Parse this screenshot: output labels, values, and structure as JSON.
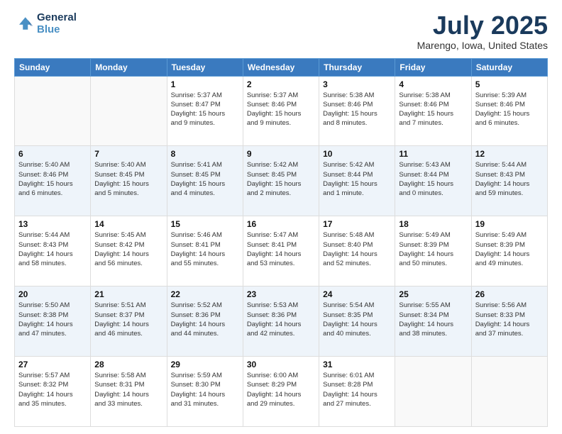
{
  "logo": {
    "line1": "General",
    "line2": "Blue"
  },
  "title": "July 2025",
  "location": "Marengo, Iowa, United States",
  "weekdays": [
    "Sunday",
    "Monday",
    "Tuesday",
    "Wednesday",
    "Thursday",
    "Friday",
    "Saturday"
  ],
  "weeks": [
    [
      {
        "day": "",
        "info": ""
      },
      {
        "day": "",
        "info": ""
      },
      {
        "day": "1",
        "info": "Sunrise: 5:37 AM\nSunset: 8:47 PM\nDaylight: 15 hours\nand 9 minutes."
      },
      {
        "day": "2",
        "info": "Sunrise: 5:37 AM\nSunset: 8:46 PM\nDaylight: 15 hours\nand 9 minutes."
      },
      {
        "day": "3",
        "info": "Sunrise: 5:38 AM\nSunset: 8:46 PM\nDaylight: 15 hours\nand 8 minutes."
      },
      {
        "day": "4",
        "info": "Sunrise: 5:38 AM\nSunset: 8:46 PM\nDaylight: 15 hours\nand 7 minutes."
      },
      {
        "day": "5",
        "info": "Sunrise: 5:39 AM\nSunset: 8:46 PM\nDaylight: 15 hours\nand 6 minutes."
      }
    ],
    [
      {
        "day": "6",
        "info": "Sunrise: 5:40 AM\nSunset: 8:46 PM\nDaylight: 15 hours\nand 6 minutes."
      },
      {
        "day": "7",
        "info": "Sunrise: 5:40 AM\nSunset: 8:45 PM\nDaylight: 15 hours\nand 5 minutes."
      },
      {
        "day": "8",
        "info": "Sunrise: 5:41 AM\nSunset: 8:45 PM\nDaylight: 15 hours\nand 4 minutes."
      },
      {
        "day": "9",
        "info": "Sunrise: 5:42 AM\nSunset: 8:45 PM\nDaylight: 15 hours\nand 2 minutes."
      },
      {
        "day": "10",
        "info": "Sunrise: 5:42 AM\nSunset: 8:44 PM\nDaylight: 15 hours\nand 1 minute."
      },
      {
        "day": "11",
        "info": "Sunrise: 5:43 AM\nSunset: 8:44 PM\nDaylight: 15 hours\nand 0 minutes."
      },
      {
        "day": "12",
        "info": "Sunrise: 5:44 AM\nSunset: 8:43 PM\nDaylight: 14 hours\nand 59 minutes."
      }
    ],
    [
      {
        "day": "13",
        "info": "Sunrise: 5:44 AM\nSunset: 8:43 PM\nDaylight: 14 hours\nand 58 minutes."
      },
      {
        "day": "14",
        "info": "Sunrise: 5:45 AM\nSunset: 8:42 PM\nDaylight: 14 hours\nand 56 minutes."
      },
      {
        "day": "15",
        "info": "Sunrise: 5:46 AM\nSunset: 8:41 PM\nDaylight: 14 hours\nand 55 minutes."
      },
      {
        "day": "16",
        "info": "Sunrise: 5:47 AM\nSunset: 8:41 PM\nDaylight: 14 hours\nand 53 minutes."
      },
      {
        "day": "17",
        "info": "Sunrise: 5:48 AM\nSunset: 8:40 PM\nDaylight: 14 hours\nand 52 minutes."
      },
      {
        "day": "18",
        "info": "Sunrise: 5:49 AM\nSunset: 8:39 PM\nDaylight: 14 hours\nand 50 minutes."
      },
      {
        "day": "19",
        "info": "Sunrise: 5:49 AM\nSunset: 8:39 PM\nDaylight: 14 hours\nand 49 minutes."
      }
    ],
    [
      {
        "day": "20",
        "info": "Sunrise: 5:50 AM\nSunset: 8:38 PM\nDaylight: 14 hours\nand 47 minutes."
      },
      {
        "day": "21",
        "info": "Sunrise: 5:51 AM\nSunset: 8:37 PM\nDaylight: 14 hours\nand 46 minutes."
      },
      {
        "day": "22",
        "info": "Sunrise: 5:52 AM\nSunset: 8:36 PM\nDaylight: 14 hours\nand 44 minutes."
      },
      {
        "day": "23",
        "info": "Sunrise: 5:53 AM\nSunset: 8:36 PM\nDaylight: 14 hours\nand 42 minutes."
      },
      {
        "day": "24",
        "info": "Sunrise: 5:54 AM\nSunset: 8:35 PM\nDaylight: 14 hours\nand 40 minutes."
      },
      {
        "day": "25",
        "info": "Sunrise: 5:55 AM\nSunset: 8:34 PM\nDaylight: 14 hours\nand 38 minutes."
      },
      {
        "day": "26",
        "info": "Sunrise: 5:56 AM\nSunset: 8:33 PM\nDaylight: 14 hours\nand 37 minutes."
      }
    ],
    [
      {
        "day": "27",
        "info": "Sunrise: 5:57 AM\nSunset: 8:32 PM\nDaylight: 14 hours\nand 35 minutes."
      },
      {
        "day": "28",
        "info": "Sunrise: 5:58 AM\nSunset: 8:31 PM\nDaylight: 14 hours\nand 33 minutes."
      },
      {
        "day": "29",
        "info": "Sunrise: 5:59 AM\nSunset: 8:30 PM\nDaylight: 14 hours\nand 31 minutes."
      },
      {
        "day": "30",
        "info": "Sunrise: 6:00 AM\nSunset: 8:29 PM\nDaylight: 14 hours\nand 29 minutes."
      },
      {
        "day": "31",
        "info": "Sunrise: 6:01 AM\nSunset: 8:28 PM\nDaylight: 14 hours\nand 27 minutes."
      },
      {
        "day": "",
        "info": ""
      },
      {
        "day": "",
        "info": ""
      }
    ]
  ]
}
